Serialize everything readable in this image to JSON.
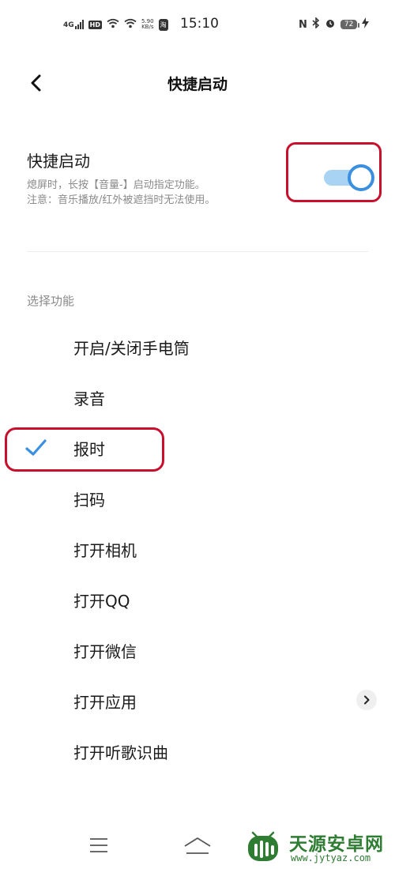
{
  "status_bar": {
    "signal": "4G",
    "hd": "HD",
    "net_speed_value": "5.90",
    "net_speed_unit": "KB/s",
    "app_badge": "淘",
    "time": "15:10",
    "nfc": "N",
    "battery": "72"
  },
  "header": {
    "title": "快捷启动"
  },
  "quick_launch": {
    "title": "快捷启动",
    "desc_line1": "熄屏时，长按【音量-】启动指定功能。",
    "desc_line2": "注意：音乐播放/红外被遮挡时无法使用。",
    "enabled": true
  },
  "section_label": "选择功能",
  "options": [
    {
      "label": "开启/关闭手电筒",
      "selected": false
    },
    {
      "label": "录音",
      "selected": false
    },
    {
      "label": "报时",
      "selected": true
    },
    {
      "label": "扫码",
      "selected": false
    },
    {
      "label": "打开相机",
      "selected": false
    },
    {
      "label": "打开QQ",
      "selected": false
    },
    {
      "label": "打开微信",
      "selected": false
    },
    {
      "label": "打开应用",
      "selected": false,
      "has_chevron": true
    },
    {
      "label": "打开听歌识曲",
      "selected": false
    }
  ],
  "watermark": {
    "title": "天源安卓网",
    "url": "www.jytyaz.com"
  },
  "colors": {
    "accent": "#3a8fe0",
    "toggle_track": "#a8d3f2",
    "annotation": "#c8102e",
    "watermark": "#2e7d32"
  }
}
